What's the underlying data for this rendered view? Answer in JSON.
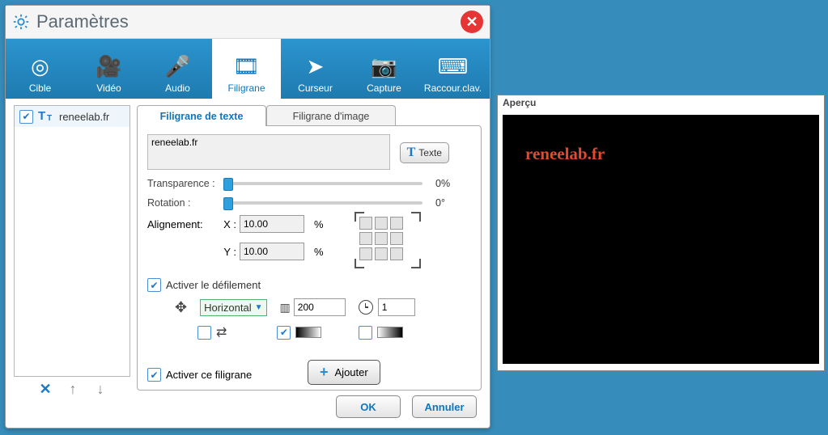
{
  "window": {
    "title": "Paramètres"
  },
  "toolbar": {
    "cible": "Cible",
    "video": "Vidéo",
    "audio": "Audio",
    "filigrane": "Filigrane",
    "curseur": "Curseur",
    "capture": "Capture",
    "raccourci": "Raccour.clav."
  },
  "sidebar": {
    "items": [
      {
        "label": "reneelab.fr",
        "checked": true
      }
    ]
  },
  "tabs": {
    "text": "Filigrane de texte",
    "image": "Filigrane d'image"
  },
  "form": {
    "watermark_text": "reneelab.fr",
    "text_btn": "Texte",
    "transparency_label": "Transparence :",
    "transparency_value": "0%",
    "rotation_label": "Rotation :",
    "rotation_value": "0°",
    "alignment_label": "Alignement:",
    "x_label": "X :",
    "x_value": "10.00",
    "y_label": "Y :",
    "y_value": "10.00",
    "pct": "%",
    "enable_scroll": "Activer le défilement",
    "scroll_dir": "Horizontal",
    "scroll_px": "200",
    "scroll_time": "1",
    "activate": "Activer ce filigrane",
    "add_btn": "Ajouter"
  },
  "buttons": {
    "ok": "OK",
    "cancel": "Annuler"
  },
  "preview": {
    "title": "Aperçu",
    "text": "reneelab.fr"
  }
}
